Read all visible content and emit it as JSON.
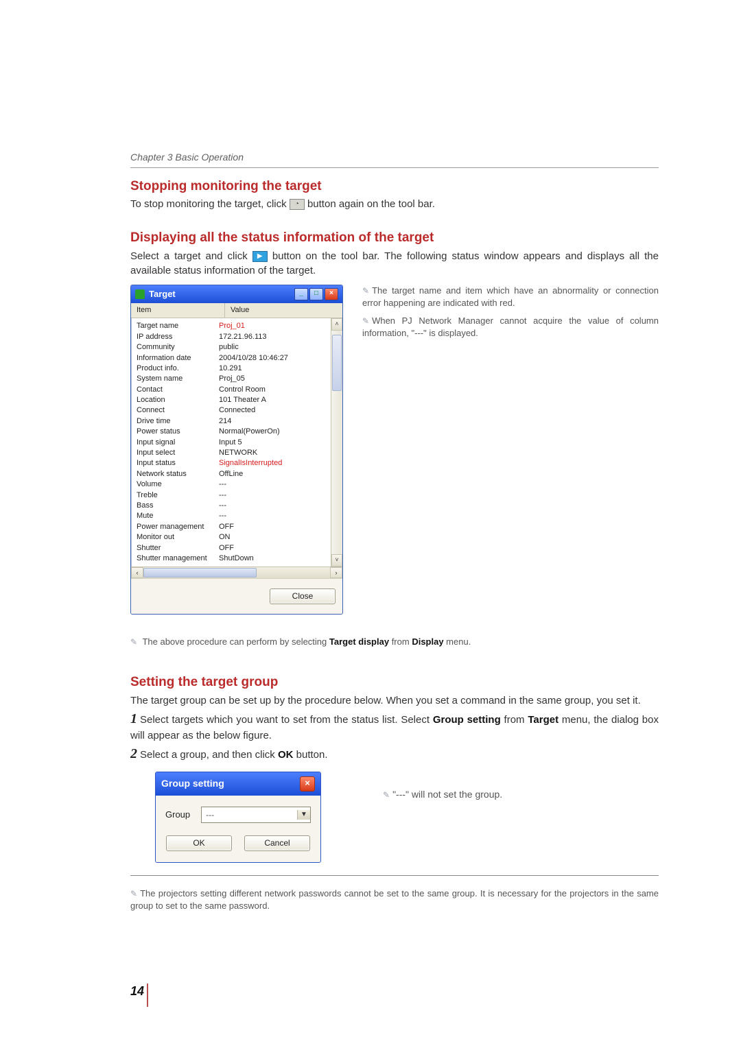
{
  "chapter": "Chapter 3 Basic Operation",
  "page_number": "14",
  "section1": {
    "title": "Stopping monitoring the target",
    "text_before_icon": "To stop monitoring the target, click ",
    "text_after_icon": " button again on the tool bar."
  },
  "section2": {
    "title": "Displaying all the status information of the target",
    "text_before_icon": "Select a target and click ",
    "text_after_icon": " button on the tool bar. The following status window appears and displays all the available status information of the target."
  },
  "status_window": {
    "title": "Target",
    "col_item": "Item",
    "col_value": "Value",
    "close_label": "Close",
    "rows": [
      {
        "item": "Target name",
        "value": "Proj_01",
        "abn": true
      },
      {
        "item": "IP address",
        "value": "172.21.96.113"
      },
      {
        "item": "Community",
        "value": "public"
      },
      {
        "item": "Information date",
        "value": "2004/10/28 10:46:27"
      },
      {
        "item": "Product info.",
        "value": "10.291"
      },
      {
        "item": "System name",
        "value": "Proj_05"
      },
      {
        "item": "Contact",
        "value": "Control Room"
      },
      {
        "item": "Location",
        "value": "101 Theater A"
      },
      {
        "item": "Connect",
        "value": "Connected"
      },
      {
        "item": "Drive time",
        "value": "214"
      },
      {
        "item": "Power status",
        "value": "Normal(PowerOn)"
      },
      {
        "item": "Input signal",
        "value": "Input 5"
      },
      {
        "item": "Input select",
        "value": "NETWORK"
      },
      {
        "item": "Input status",
        "value": "SignalIsInterrupted",
        "abn": true
      },
      {
        "item": "Network status",
        "value": "OffLine"
      },
      {
        "item": "Volume",
        "value": "---"
      },
      {
        "item": "Treble",
        "value": "---"
      },
      {
        "item": "Bass",
        "value": "---"
      },
      {
        "item": "Mute",
        "value": "---"
      },
      {
        "item": "Power management",
        "value": "OFF"
      },
      {
        "item": "Monitor out",
        "value": "ON"
      },
      {
        "item": "Shutter",
        "value": "OFF"
      },
      {
        "item": "Shutter management",
        "value": "ShutDown"
      }
    ]
  },
  "status_notes": {
    "n1": "The target name and item which have an abnormality or connection error happening are indicated with red.",
    "n2": "When PJ Network Manager cannot acquire the value of column information, \"---\" is displayed."
  },
  "proc_note_prefix": "The above procedure can perform by selecting ",
  "proc_note_bold1": "Target display",
  "proc_note_mid": " from ",
  "proc_note_bold2": "Display",
  "proc_note_suffix": " menu.",
  "section3": {
    "title": "Setting the target group",
    "intro": "The target group can be set up by the procedure below. When you set a command in the same group, you set it.",
    "step1_num": "1",
    "step1_a": "Select targets which you want to set from the status list. Select ",
    "step1_b": "Group setting",
    "step1_c": " from ",
    "step1_d": "Target",
    "step1_e": " menu, the dialog box will appear as the below figure.",
    "step2_num": "2",
    "step2_a": "Select a group, and then click ",
    "step2_b": "OK",
    "step2_c": " button."
  },
  "group_dialog": {
    "title": "Group setting",
    "label": "Group",
    "value": "---",
    "ok": "OK",
    "cancel": "Cancel"
  },
  "group_note": "\"---\" will not set the group.",
  "footer_note": "The projectors setting different network passwords cannot be set to the same group. It is necessary for the projectors in the same group to set to the same password."
}
